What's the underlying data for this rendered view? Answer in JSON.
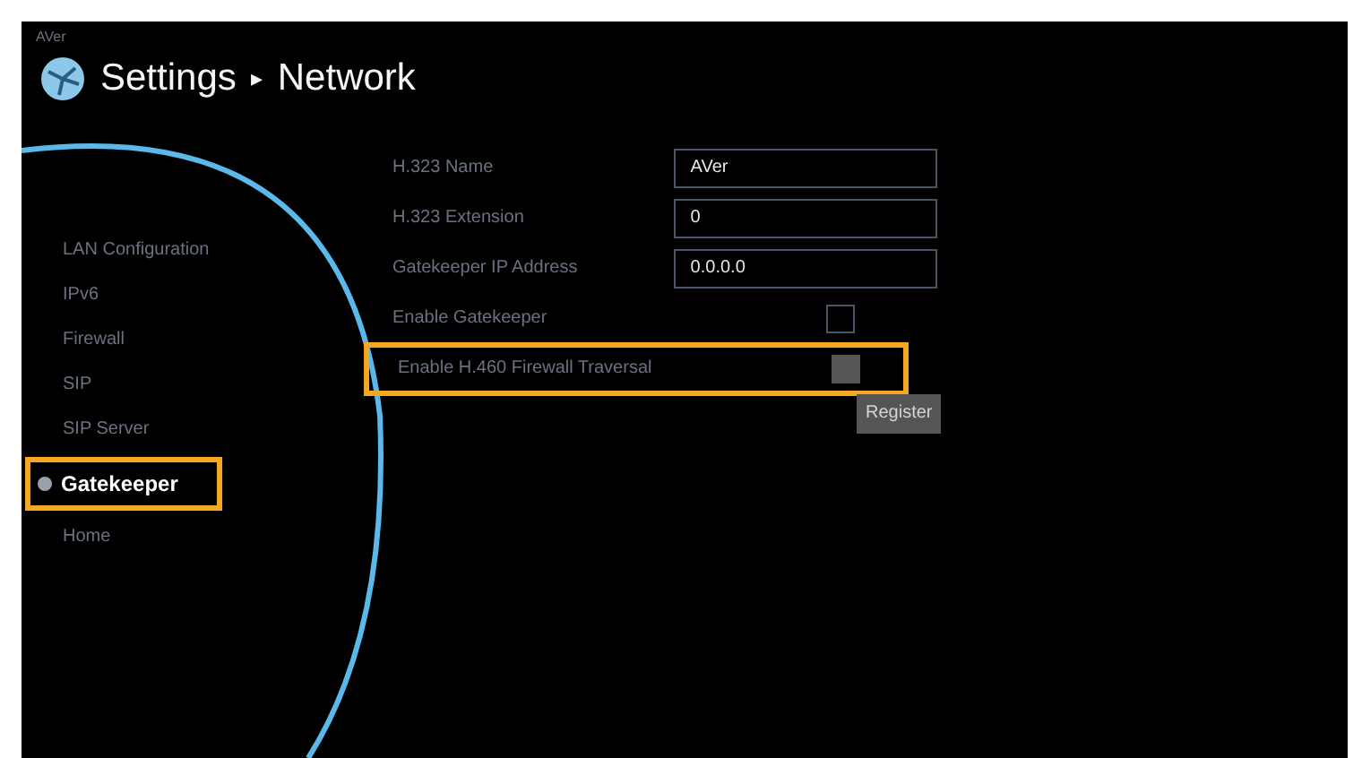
{
  "brand": "AVer",
  "breadcrumb": [
    "Settings",
    "▸",
    "Network"
  ],
  "sidebar": {
    "items": [
      {
        "label": "LAN Configuration",
        "selected": false,
        "highlighted": false
      },
      {
        "label": "IPv6",
        "selected": false,
        "highlighted": false
      },
      {
        "label": "Firewall",
        "selected": false,
        "highlighted": false
      },
      {
        "label": "SIP",
        "selected": false,
        "highlighted": false
      },
      {
        "label": "SIP Server",
        "selected": false,
        "highlighted": false
      },
      {
        "label": "Gatekeeper",
        "selected": true,
        "highlighted": true
      },
      {
        "label": "Home",
        "selected": false,
        "highlighted": false
      }
    ]
  },
  "form": {
    "rows": [
      {
        "kind": "field",
        "label": "H.323 Name",
        "value": "AVer",
        "highlighted": false
      },
      {
        "kind": "field",
        "label": "H.323 Extension",
        "value": "0",
        "highlighted": false
      },
      {
        "kind": "field",
        "label": "Gatekeeper IP Address",
        "value": "0.0.0.0",
        "highlighted": false
      },
      {
        "kind": "checkbox",
        "label": "Enable Gatekeeper",
        "focused": false,
        "highlighted": false
      },
      {
        "kind": "checkbox",
        "label": "Enable H.460 Firewall Traversal",
        "focused": true,
        "highlighted": true
      }
    ],
    "button": "Register"
  }
}
